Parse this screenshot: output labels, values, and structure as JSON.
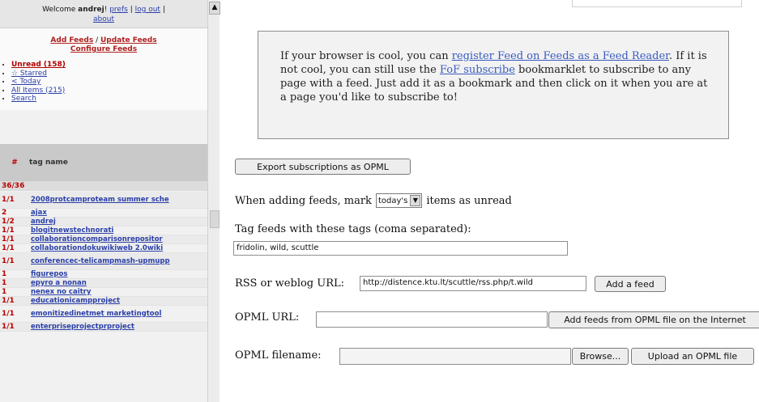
{
  "sidebar": {
    "welcome_prefix": "Welcome",
    "username": "andrej",
    "welcome_suffix": "!",
    "prefs": "prefs",
    "logout": "log out",
    "about": "about",
    "sep1": "|",
    "sep2": "|",
    "add_feeds": "Add Feeds",
    "slash": "/",
    "update_feeds": "Update Feeds",
    "configure_feeds": "Configure Feeds",
    "nav": [
      {
        "label": "Unread (158)"
      },
      {
        "label": "☆ Starred"
      },
      {
        "label": "< Today"
      },
      {
        "label": "All Items (215)"
      },
      {
        "label": "Search"
      }
    ],
    "tag_header_hash": "#",
    "tag_header_name": "tag name",
    "tag_count": "36/36",
    "tags": [
      {
        "count": "1/1",
        "name": "2008protcamproteam summer sche"
      },
      {
        "count": "2",
        "name": "ajax"
      },
      {
        "count": "1/2",
        "name": "andrej"
      },
      {
        "count": "1/1",
        "name": "blogitnewstechnorati"
      },
      {
        "count": "1/1",
        "name": "collaborationcomparisonrepositor"
      },
      {
        "count": "1/1",
        "name": "collaborationdokuwikiweb 2.0wiki"
      },
      {
        "count": "1/1",
        "name": "conferencec-telicampmash-upmupp"
      },
      {
        "count": "1",
        "name": "figurepos"
      },
      {
        "count": "1",
        "name": "epyro a nonan"
      },
      {
        "count": "1",
        "name": "nenex no caitry"
      },
      {
        "count": "1/1",
        "name": "educationicampproject"
      },
      {
        "count": "1/1",
        "name": "emonitizedinetmet marketingtool"
      },
      {
        "count": "1/1",
        "name": "enterpriseprojectprproject"
      }
    ]
  },
  "info": {
    "t1": "If your browser is cool, you can ",
    "link1": "register Feed on Feeds as a Feed Reader",
    "t2": ". If it is not cool, you can still use the ",
    "link2": "FoF subscribe",
    "t3": " bookmarklet to subscribe to any page with a feed. Just add it as a bookmark and then click on it when you are at a page you'd like to subscribe to!"
  },
  "export_label": "Export subscriptions as OPML",
  "mark": {
    "prefix": "When adding feeds, mark",
    "selected": "today's",
    "suffix": "items as unread"
  },
  "tags_label": "Tag feeds with these tags (coma separated):",
  "tags_value": "fridolin, wild, scuttle",
  "rss_label": "RSS or weblog URL:",
  "rss_value": "http://distence.ktu.lt/scuttle/rss.php/t.wild",
  "add_feed_label": "Add a feed",
  "opml_url_label": "OPML URL:",
  "opml_url_btn": "Add feeds from OPML file on the Internet",
  "opml_file_label": "OPML filename:",
  "browse_label": "Browse...",
  "upload_label": "Upload an OPML file"
}
